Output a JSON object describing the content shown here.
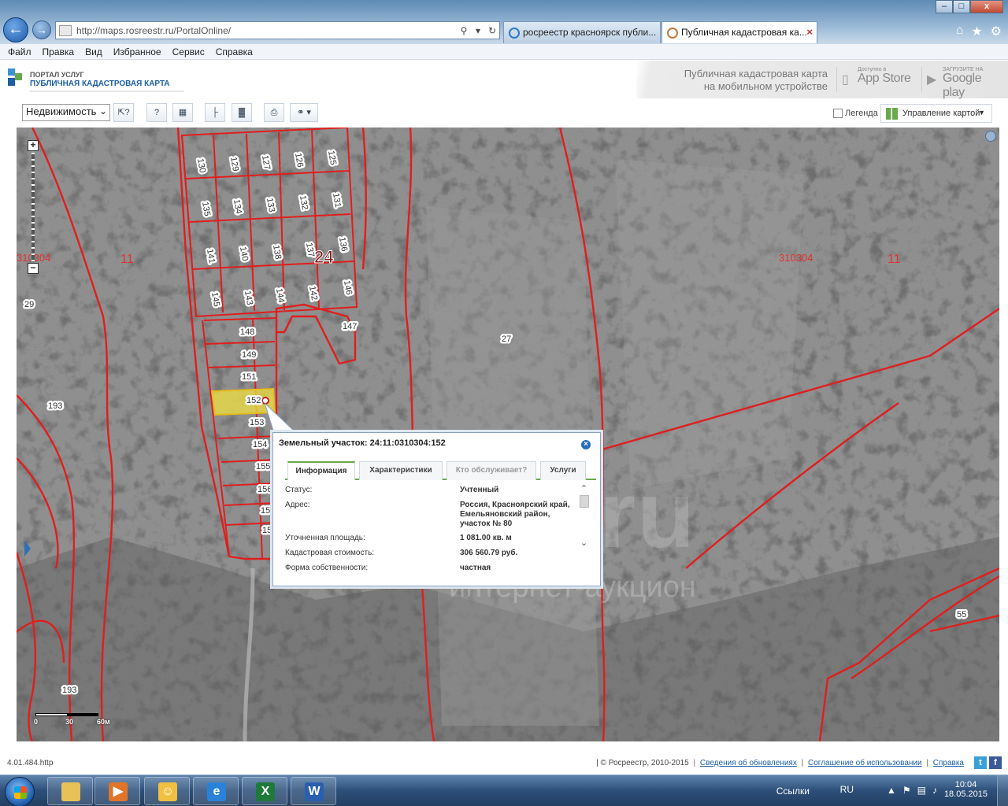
{
  "browser": {
    "url": "http://maps.rosreestr.ru/PortalOnline/",
    "tabs": [
      {
        "label": "росреестр красноярск публи..."
      },
      {
        "label": "Публичная кадастровая ка..."
      }
    ],
    "tab_close": "×",
    "window_controls": {
      "minimize": "–",
      "maximize": "□",
      "close": "x"
    },
    "menu": [
      "Файл",
      "Правка",
      "Вид",
      "Избранное",
      "Сервис",
      "Справка"
    ]
  },
  "portal": {
    "logo_line1": "ПОРТАЛ УСЛУГ",
    "logo_line2": "ПУБЛИЧНАЯ КАДАСТРОВАЯ КАРТА",
    "mobile_line1": "Публичная кадастровая карта",
    "mobile_line2": "на мобильном устройстве",
    "appstore_small": "Доступно в",
    "appstore_big": "App Store",
    "googleplay_small": "ЗАГРУЗИТЕ НА",
    "googleplay_big": "Google play"
  },
  "toolbar": {
    "layer_select": "Недвижимость",
    "legend_label": "Легенда",
    "map_control_label": "Управление картой",
    "tool_icons": [
      "select-info-icon",
      "question-icon",
      "search-map-icon",
      "measure-icon",
      "layers-icon",
      "print-icon",
      "link-icon"
    ]
  },
  "map": {
    "labels": {
      "quarter_left": "310304",
      "quarter_right": "310304",
      "district_left": "11",
      "district_right": "11",
      "block": "24"
    },
    "parcels_grid": [
      "130",
      "129",
      "127",
      "126",
      "125",
      "135",
      "134",
      "133",
      "132",
      "131",
      "141",
      "140",
      "138",
      "137",
      "136",
      "145",
      "143",
      "144",
      "142",
      "146"
    ],
    "parcels_column": [
      "148",
      "149",
      "151",
      "152",
      "153",
      "154",
      "155",
      "156",
      "157",
      "158"
    ],
    "other_parcels": [
      "147",
      "27",
      "29",
      "193",
      "193",
      "55"
    ],
    "scale": {
      "zero": "0",
      "mid": "30",
      "end": "60м"
    },
    "zoom_in": "+",
    "zoom_out": "−"
  },
  "popup": {
    "title": "Земельный участок: 24:11:0310304:152",
    "close": "×",
    "tabs": [
      "Информация",
      "Характеристики",
      "Кто обслуживает?",
      "Услуги"
    ],
    "rows": [
      {
        "label": "Статус:",
        "value": "Учтенный"
      },
      {
        "label": "Адрес:",
        "value": "Россия, Красноярский край, Емельяновский район, участок № 80"
      },
      {
        "label": "Уточненная площадь:",
        "value": "1 081.00 кв. м"
      },
      {
        "label": "Кадастровая стоимость:",
        "value": "306 560.79 руб."
      },
      {
        "label": "Форма собственности:",
        "value": "частная"
      }
    ]
  },
  "footer": {
    "version": "4.01.484.http",
    "copyright": "| © Росреестр, 2010-2015",
    "links": [
      "Сведения об обновлениях",
      "Соглашение об использовании",
      "Справка"
    ]
  },
  "watermark": {
    "big": ".ru",
    "small": "интернет-аукцион"
  },
  "taskbar": {
    "links": "Ссылки",
    "lang": "RU",
    "time": "10:04",
    "date": "18.05.2015"
  }
}
